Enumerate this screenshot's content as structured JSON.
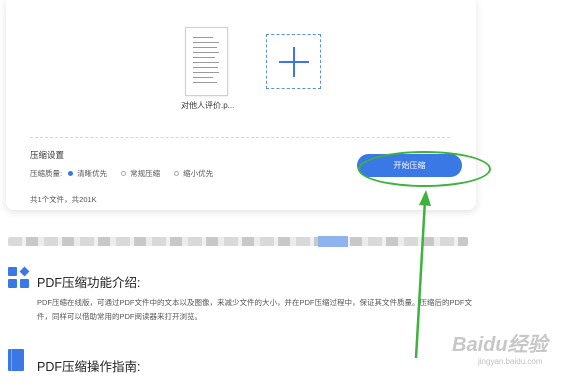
{
  "upload": {
    "file_name": "对他人评价.p...",
    "add_icon": "plus-icon"
  },
  "settings": {
    "title": "压缩设置",
    "quality_label": "压缩质量:",
    "options": [
      "清晰优先",
      "常规压缩",
      "缩小优先"
    ],
    "selected": "清晰优先"
  },
  "start_button": "开始压缩",
  "file_count": "共1个文件，共201K",
  "intro": {
    "title": "PDF压缩功能介绍:",
    "description": "PDF压缩在线版，可通过PDF文件中的文本以及图像，来减少文件的大小，并在PDF压缩过程中，保证其文件质量。压缩后的PDF文件，同样可以借助常用的PDF阅读器来打开浏览。"
  },
  "guide": {
    "title": "PDF压缩操作指南:"
  },
  "watermark": {
    "text": "Baidu经验",
    "sub": "jingyan.baidu.com"
  },
  "colors": {
    "accent": "#3a78e6",
    "annotation": "#3db23d"
  }
}
